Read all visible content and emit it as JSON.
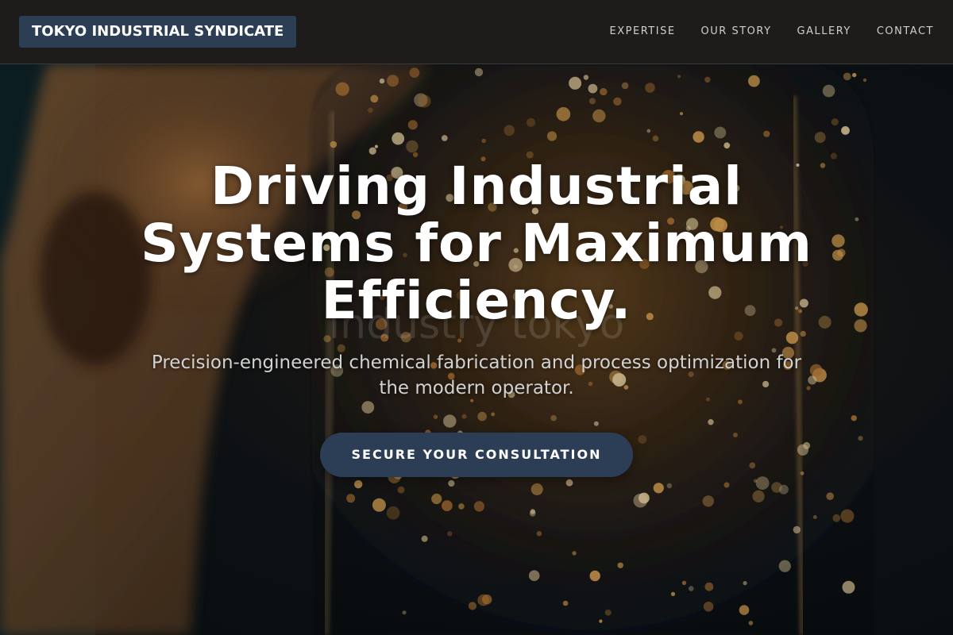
{
  "header": {
    "brand": "TOKYO INDUSTRIAL SYNDICATE",
    "nav": [
      {
        "label": "EXPERTISE"
      },
      {
        "label": "OUR STORY"
      },
      {
        "label": "GALLERY"
      },
      {
        "label": "CONTACT"
      }
    ]
  },
  "hero": {
    "headline": "Driving Industrial Systems for Maximum Efficiency.",
    "watermark": "industry tokyo",
    "subheadline": "Precision-engineered chemical fabrication and process optimization for the modern operator.",
    "cta_label": "SECURE YOUR CONSULTATION"
  },
  "colors": {
    "header_bg": "#1d1c1b",
    "brand_bg": "#2c3e53",
    "cta_bg": "#2c3e55",
    "headline": "#ffffff",
    "accent_glow": "#e0a24a"
  }
}
